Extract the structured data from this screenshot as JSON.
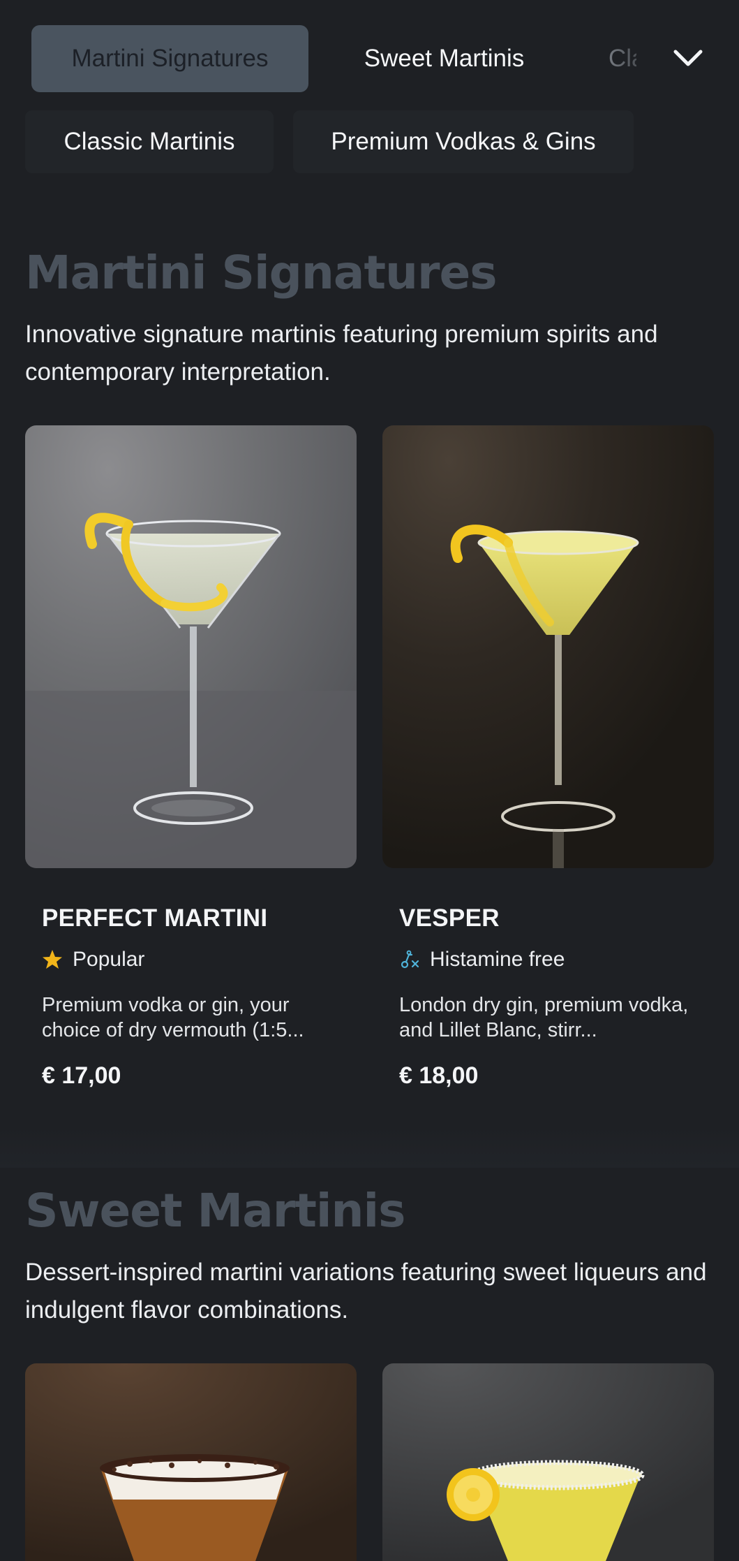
{
  "nav": {
    "tabs": [
      {
        "label": "Martini Signatures"
      },
      {
        "label": "Sweet Martinis"
      },
      {
        "label": "Cla"
      },
      {
        "label": "Classic Martinis"
      },
      {
        "label": "Premium Vodkas & Gins"
      }
    ],
    "active_index": 0
  },
  "sections": [
    {
      "title": "Martini Signatures",
      "description": "Innovative signature martinis featuring premium spirits and contemporary interpretation.",
      "items": [
        {
          "name": "PERFECT MARTINI",
          "tag": "Popular",
          "tag_icon": "star-icon",
          "description": "Premium vodka or gin, your choice of dry vermouth (1:5...",
          "price": "€ 17,00"
        },
        {
          "name": "VESPER",
          "tag": "Histamine free",
          "tag_icon": "histamine-free-icon",
          "description": "London dry gin, premium vodka, and Lillet Blanc, stirr...",
          "price": "€ 18,00"
        }
      ]
    },
    {
      "title": "Sweet Martinis",
      "description": "Dessert-inspired martini variations featuring sweet liqueurs and indulgent flavor combinations."
    }
  ],
  "colors": {
    "background": "#1e2024",
    "active_tab": "#4a545f",
    "section_title": "#4a525c",
    "star": "#f2b51a",
    "histamine_icon": "#4fb3d9"
  }
}
